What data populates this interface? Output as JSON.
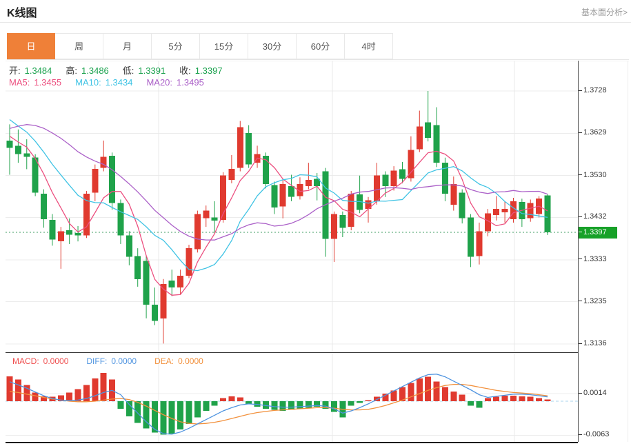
{
  "header": {
    "title": "K线图",
    "link": "基本面分析>"
  },
  "tabs": [
    {
      "label": "日",
      "active": true
    },
    {
      "label": "周",
      "active": false
    },
    {
      "label": "月",
      "active": false
    },
    {
      "label": "5分",
      "active": false
    },
    {
      "label": "15分",
      "active": false
    },
    {
      "label": "30分",
      "active": false
    },
    {
      "label": "60分",
      "active": false
    },
    {
      "label": "4时",
      "active": false
    }
  ],
  "ohlc_legend": {
    "open_label": "开:",
    "open": "1.3484",
    "high_label": "高:",
    "high": "1.3486",
    "low_label": "低:",
    "low": "1.3391",
    "close_label": "收:",
    "close": "1.3397"
  },
  "ma_legend": {
    "ma5_label": "MA5:",
    "ma5": "1.3455",
    "ma10_label": "MA10:",
    "ma10": "1.3434",
    "ma20_label": "MA20:",
    "ma20": "1.3495"
  },
  "macd_legend": {
    "macd_label": "MACD:",
    "macd": "0.0000",
    "diff_label": "DIFF:",
    "diff": "0.0000",
    "dea_label": "DEA:",
    "dea": "0.0000"
  },
  "colors": {
    "up": "#e03a2f",
    "down": "#1fa24a",
    "ma5": "#ec4f7f",
    "ma10": "#3fc3e4",
    "ma20": "#ab60c8",
    "diff": "#4f94e0",
    "dea": "#f2913d",
    "macd_label": "#ef4f4f",
    "ohlc_value": "#1ba24e",
    "label_text": "#333333",
    "grid": "#ececec",
    "vgrid": "#e8e8e8",
    "price_line": "#3f9e63",
    "price_tag_bg": "#17a128",
    "zero_dash": "#a9d5ec",
    "tab_active_bg": "#ef8038"
  },
  "chart_data": [
    {
      "type": "candlestick",
      "title": "K线图",
      "period": "日",
      "legend_position": "top-left",
      "grid": true,
      "y_ticks": [
        {
          "label": "1.3728",
          "value": 1.3728
        },
        {
          "label": "1.3629",
          "value": 1.3629
        },
        {
          "label": "1.3530",
          "value": 1.353
        },
        {
          "label": "1.3432",
          "value": 1.3432
        },
        {
          "label": "1.3333",
          "value": 1.3333
        },
        {
          "label": "1.3235",
          "value": 1.3235
        },
        {
          "label": "1.3136",
          "value": 1.3136
        }
      ],
      "ylim": [
        1.3136,
        1.3728
      ],
      "current_price": 1.3397,
      "current_price_label": "1.3397",
      "ma_periods": [
        5,
        10,
        20
      ],
      "ma_seed_closes": [
        1.344,
        1.347,
        1.35,
        1.353,
        1.356,
        1.36,
        1.365,
        1.369,
        1.372,
        1.3735,
        1.3738,
        1.373,
        1.3718,
        1.3702,
        1.3685,
        1.3665,
        1.3648,
        1.3634,
        1.3622,
        1.3612
      ],
      "candles_ohlc": [
        [
          1.3612,
          1.365,
          1.3532,
          1.3595
        ],
        [
          1.36,
          1.3638,
          1.356,
          1.358
        ],
        [
          1.3582,
          1.3615,
          1.3545,
          1.3574
        ],
        [
          1.3572,
          1.358,
          1.3482,
          1.349
        ],
        [
          1.3488,
          1.3498,
          1.3408,
          1.3428
        ],
        [
          1.3426,
          1.344,
          1.3366,
          1.338
        ],
        [
          1.3376,
          1.341,
          1.3312,
          1.34
        ],
        [
          1.3402,
          1.343,
          1.337,
          1.3392
        ],
        [
          1.3396,
          1.3412,
          1.3376,
          1.339
        ],
        [
          1.339,
          1.3494,
          1.3384,
          1.3488
        ],
        [
          1.349,
          1.3556,
          1.347,
          1.3546
        ],
        [
          1.3548,
          1.3612,
          1.354,
          1.3574
        ],
        [
          1.3576,
          1.3584,
          1.345,
          1.3466
        ],
        [
          1.3466,
          1.3474,
          1.337,
          1.339
        ],
        [
          1.339,
          1.34,
          1.332,
          1.334
        ],
        [
          1.3342,
          1.336,
          1.327,
          1.3288
        ],
        [
          1.333,
          1.3342,
          1.3196,
          1.3228
        ],
        [
          1.3228,
          1.3268,
          1.318,
          1.319
        ],
        [
          1.3196,
          1.3288,
          1.3137,
          1.3276
        ],
        [
          1.3284,
          1.331,
          1.3248,
          1.3268
        ],
        [
          1.3268,
          1.331,
          1.3252,
          1.3296
        ],
        [
          1.3296,
          1.3368,
          1.329,
          1.336
        ],
        [
          1.3358,
          1.3448,
          1.335,
          1.344
        ],
        [
          1.343,
          1.346,
          1.341,
          1.3448
        ],
        [
          1.3432,
          1.347,
          1.3395,
          1.3425
        ],
        [
          1.3426,
          1.3538,
          1.342,
          1.353
        ],
        [
          1.352,
          1.3578,
          1.3512,
          1.3546
        ],
        [
          1.3548,
          1.3658,
          1.354,
          1.3643
        ],
        [
          1.363,
          1.3648,
          1.3548,
          1.3556
        ],
        [
          1.356,
          1.36,
          1.3548,
          1.358
        ],
        [
          1.3576,
          1.3584,
          1.35,
          1.351
        ],
        [
          1.3508,
          1.3516,
          1.344,
          1.3455
        ],
        [
          1.3458,
          1.352,
          1.343,
          1.351
        ],
        [
          1.3505,
          1.3532,
          1.347,
          1.348
        ],
        [
          1.3482,
          1.3526,
          1.3474,
          1.351
        ],
        [
          1.3505,
          1.356,
          1.3498,
          1.352
        ],
        [
          1.3522,
          1.3536,
          1.3472,
          1.3505
        ],
        [
          1.354,
          1.3548,
          1.334,
          1.3382
        ],
        [
          1.3382,
          1.3446,
          1.3328,
          1.344
        ],
        [
          1.3438,
          1.3446,
          1.3386,
          1.3408
        ],
        [
          1.341,
          1.3494,
          1.3402,
          1.3488
        ],
        [
          1.3486,
          1.353,
          1.3442,
          1.345
        ],
        [
          1.3452,
          1.348,
          1.342,
          1.3472
        ],
        [
          1.347,
          1.356,
          1.3462,
          1.353
        ],
        [
          1.3532,
          1.354,
          1.348,
          1.3505
        ],
        [
          1.3505,
          1.3552,
          1.3495,
          1.3542
        ],
        [
          1.3545,
          1.3562,
          1.3512,
          1.3522
        ],
        [
          1.3524,
          1.3622,
          1.3516,
          1.359
        ],
        [
          1.3592,
          1.3682,
          1.3585,
          1.3645
        ],
        [
          1.3655,
          1.3728,
          1.361,
          1.3618
        ],
        [
          1.3648,
          1.369,
          1.355,
          1.356
        ],
        [
          1.356,
          1.3572,
          1.347,
          1.3488
        ],
        [
          1.3462,
          1.3528,
          1.3448,
          1.351
        ],
        [
          1.349,
          1.3498,
          1.3418,
          1.343
        ],
        [
          1.3432,
          1.344,
          1.3316,
          1.334
        ],
        [
          1.3342,
          1.342,
          1.3322,
          1.34
        ],
        [
          1.34,
          1.3452,
          1.3388,
          1.3442
        ],
        [
          1.3438,
          1.3482,
          1.3425,
          1.3452
        ],
        [
          1.3444,
          1.347,
          1.342,
          1.3452
        ],
        [
          1.3428,
          1.3478,
          1.342,
          1.347
        ],
        [
          1.3468,
          1.3476,
          1.341,
          1.3428
        ],
        [
          1.343,
          1.3474,
          1.3422,
          1.3466
        ],
        [
          1.344,
          1.3482,
          1.3432,
          1.3476
        ],
        [
          1.3484,
          1.3486,
          1.3391,
          1.3397
        ]
      ]
    },
    {
      "type": "bar",
      "title": "MACD",
      "y_ticks": [
        {
          "label": "0.0014",
          "value": 0.0014
        },
        {
          "label": "-0.0063",
          "value": -0.0063
        }
      ],
      "bars_1e4": [
        46,
        40,
        30,
        16,
        9,
        8,
        11,
        16,
        22,
        30,
        42,
        52,
        40,
        -14,
        -28,
        -40,
        -50,
        -58,
        -62,
        -60,
        -52,
        -42,
        -30,
        -18,
        -8,
        6,
        9,
        7,
        -6,
        -10,
        -14,
        -16,
        -18,
        -16,
        -14,
        -12,
        -10,
        -14,
        -20,
        -30,
        -8,
        -3,
        2,
        8,
        14,
        20,
        26,
        34,
        42,
        45,
        36,
        26,
        18,
        12,
        -8,
        -12,
        6,
        8,
        10,
        10,
        9,
        8,
        6,
        3
      ],
      "diff_1e4": [
        36,
        30,
        24,
        17,
        10,
        5,
        2,
        1,
        2,
        5,
        10,
        16,
        20,
        12,
        -6,
        -22,
        -38,
        -52,
        -60,
        -61,
        -57,
        -50,
        -42,
        -34,
        -26,
        -18,
        -12,
        -7,
        -5,
        -6,
        -8,
        -10,
        -11,
        -11,
        -10,
        -9,
        -8,
        -9,
        -14,
        -22,
        -18,
        -12,
        -5,
        3,
        11,
        19,
        27,
        35,
        43,
        49,
        50,
        45,
        37,
        29,
        21,
        12,
        7,
        9,
        11,
        13,
        13,
        12,
        10,
        8
      ],
      "dea_1e4": [
        18,
        16,
        13,
        10,
        7,
        4,
        2,
        0,
        -1,
        -1,
        0,
        2,
        4,
        5,
        3,
        -2,
        -9,
        -17,
        -25,
        -32,
        -38,
        -41,
        -42,
        -41,
        -39,
        -36,
        -32,
        -28,
        -24,
        -21,
        -19,
        -17,
        -16,
        -15,
        -14,
        -13,
        -12,
        -12,
        -13,
        -15,
        -16,
        -16,
        -15,
        -12,
        -8,
        -3,
        2,
        8,
        14,
        20,
        25,
        29,
        31,
        31,
        29,
        26,
        23,
        20,
        18,
        16,
        15,
        14,
        12,
        10
      ]
    }
  ]
}
